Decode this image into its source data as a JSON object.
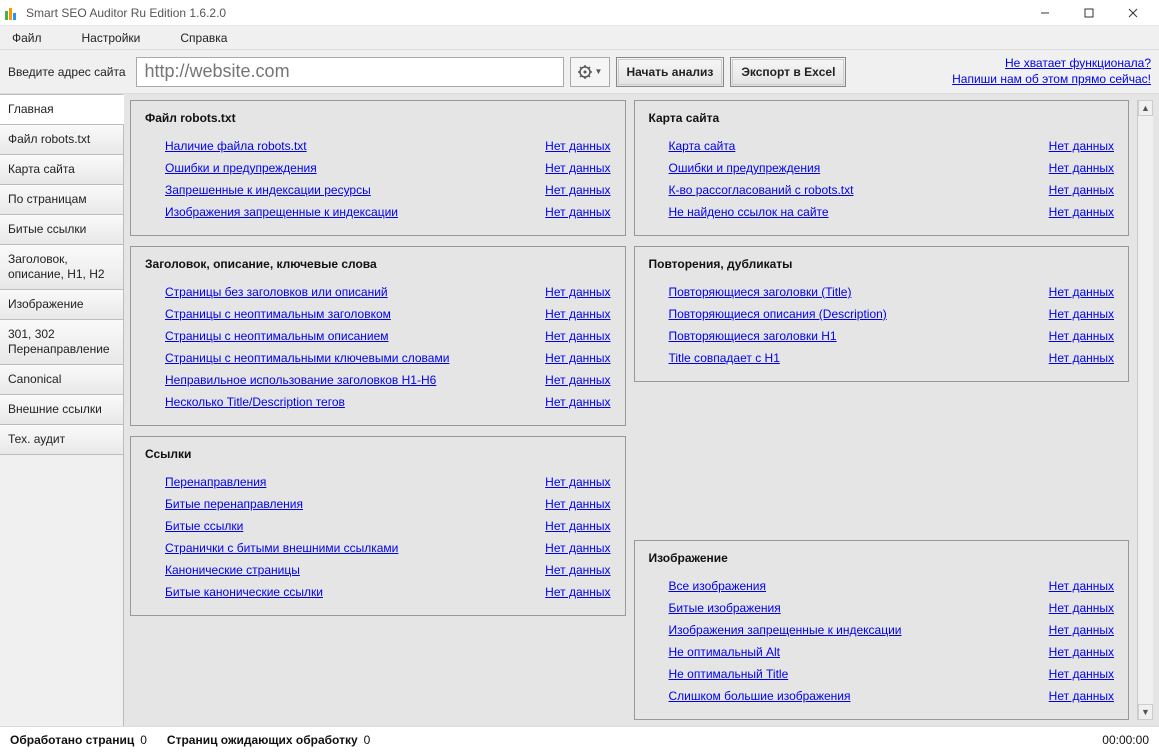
{
  "window": {
    "title": "Smart SEO Auditor Ru Edition 1.6.2.0"
  },
  "menu": {
    "file": "Файл",
    "settings": "Настройки",
    "help": "Справка"
  },
  "toolbar": {
    "label": "Введите адрес сайта",
    "url_placeholder": "http://website.com",
    "start": "Начать анализ",
    "export": "Экспорт в Excel",
    "promo1": "Не хватает функционала?",
    "promo2": "Напиши нам об этом прямо сейчас!"
  },
  "tabs": [
    "Главная",
    "Файл robots.txt",
    "Карта сайта",
    "По страницам",
    "Битые ссылки",
    "Заголовок, описание, H1, H2",
    "Изображение",
    "301, 302 Перенаправление",
    "Canonical",
    "Внешние ссылки",
    "Тех. аудит"
  ],
  "nd": "Нет данных",
  "panels": {
    "robots": {
      "title": "Файл robots.txt",
      "items": [
        "Наличие файла robots.txt",
        "Ошибки и предупреждения",
        "Запрешенные к индексации ресурсы",
        "Изображения запрещенные к индексации"
      ]
    },
    "sitemap": {
      "title": "Карта сайта",
      "items": [
        "Карта сайта",
        "Ошибки и предупреждения",
        "К-во рассогласований с robots.txt",
        "Не найдено ссылок на сайте"
      ]
    },
    "titles": {
      "title": "Заголовок, описание, ключевые слова",
      "items": [
        "Страницы без заголовков или описаний",
        "Страницы с неоптимальным заголовком",
        "Страницы с неоптимальным описанием",
        "Страницы с неоптимальными ключевыми словами",
        "Неправильное использование заголовков H1-H6",
        "Несколько Title/Description тегов"
      ]
    },
    "dupes": {
      "title": "Повторения, дубликаты",
      "items": [
        "Повторяющиеся заголовки (Title)",
        "Повторяющиеся описания (Description)",
        "Повторяющиеся заголовки H1",
        "Title совпадает с H1"
      ]
    },
    "links": {
      "title": "Ссылки",
      "items": [
        "Перенаправления",
        "Битые перенаправления",
        "Битые ссылки",
        "Странички с битыми внешними ссылками",
        "Канонические страницы",
        "Битые канонические ссылки"
      ]
    },
    "images": {
      "title": "Изображение",
      "items": [
        "Все изображения",
        "Битые изображения",
        "Изображения запрещенные к индексации",
        "Не оптимальный Alt",
        "Не оптимальный Title",
        "Слишком большие изображения"
      ]
    }
  },
  "status": {
    "processed_label": "Обработано страниц",
    "processed_value": "0",
    "pending_label": "Страниц ожидающих обработку",
    "pending_value": "0",
    "time": "00:00:00"
  }
}
